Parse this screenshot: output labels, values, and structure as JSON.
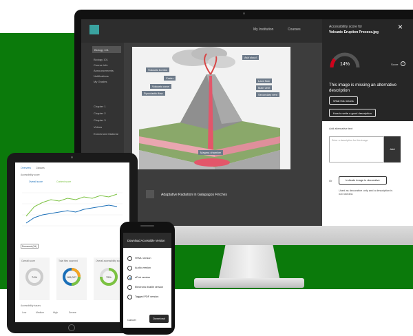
{
  "desktop": {
    "topnav": {
      "institution": "My Institution",
      "courses": "Courses"
    },
    "sidebar": {
      "course": "Biology 101",
      "items": [
        "Biology 101",
        "Course info",
        "Announcements",
        "Notifications",
        "My Grades",
        "Chapter 1",
        "Chapter 2",
        "Chapter 3",
        "Videos",
        "Enrichment Material"
      ]
    },
    "diagram_labels": {
      "ash_cloud": "Ash cloud",
      "volcanic_bombs": "Volcanic bombs",
      "crater": "Crater",
      "volcanic_cone": "Volcanic cone",
      "pyroclastic_flow": "Pyroclastic flow",
      "lava_flow": "Lava flow",
      "main_vent": "Main vent",
      "secondary_vent": "Secondary vent",
      "magma_chamber": "Magma chamber"
    },
    "caption": "Adaptative Radiation in Galapagos Finches"
  },
  "a11y_panel": {
    "title": "Accessibility score for",
    "filename": "Volcanic Eruption Process.jpg",
    "close_icon": "×",
    "score_pct": "14%",
    "score_label": "Score",
    "info_icon": "i",
    "missing_message": "This image is missing an alternative description",
    "what_means": "What this means",
    "how_to_write": "How to write a good description",
    "alt_label": "Add alternative text",
    "alt_placeholder": "Enter a description for this image",
    "add_button": "Add",
    "or": "Or",
    "decorative_button": "Indicate image is decorative",
    "decorative_hint": "Used as decorative only and a description is not needed.",
    "colors": {
      "gauge_red": "#d0021b",
      "gauge_track": "#555555"
    }
  },
  "tablet": {
    "tabs": [
      "Overview",
      "Classes"
    ],
    "chart_title": "Accessibility score",
    "legend": [
      "Overall score",
      "Content score"
    ],
    "filter_chip": "Document (2d)",
    "cards": [
      {
        "title": "Overall score",
        "value": "74%"
      },
      {
        "title": "Total files scanned",
        "value": "165,027"
      },
      {
        "title": "Overall accessibility score",
        "value": "75%"
      }
    ],
    "footer_label": "Accessibility issues",
    "issue_levels": [
      "Low",
      "Medium",
      "High",
      "Severe"
    ]
  },
  "phone": {
    "title": "Download Accessible Version",
    "options": [
      "HTML version",
      "Audio version",
      "ePub version",
      "Electronic braille version",
      "Tagged PDF version"
    ],
    "selected_index": 2,
    "cancel": "Cancel",
    "download": "Download"
  }
}
